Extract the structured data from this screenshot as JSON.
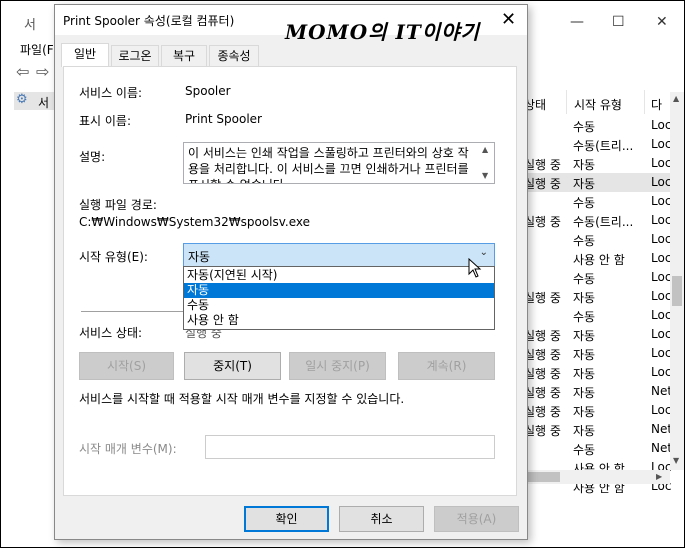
{
  "background_window": {
    "title_partial": "서",
    "menu_partial": "파일(F",
    "tree_partial": "서",
    "col_status": "상태",
    "col_startup": "시작 유형",
    "col_logon_partial": "다",
    "rows": [
      {
        "status": "",
        "startup": "수동",
        "logon": "Loc"
      },
      {
        "status": "",
        "startup": "수동(트리...",
        "logon": "Loc"
      },
      {
        "status": "실행 중",
        "startup": "자동",
        "logon": "Loc"
      },
      {
        "status": "실행 중",
        "startup": "자동",
        "logon": "Loc"
      },
      {
        "status": "",
        "startup": "수동",
        "logon": "Loc"
      },
      {
        "status": "실행 중",
        "startup": "수동(트리...",
        "logon": "Loc"
      },
      {
        "status": "",
        "startup": "수동",
        "logon": "Loc"
      },
      {
        "status": "",
        "startup": "사용 안 함",
        "logon": "Loc"
      },
      {
        "status": "",
        "startup": "수동",
        "logon": "Loc"
      },
      {
        "status": "실행 중",
        "startup": "자동",
        "logon": "Loc"
      },
      {
        "status": "",
        "startup": "수동",
        "logon": "Loc"
      },
      {
        "status": "실행 중",
        "startup": "자동",
        "logon": "Loc"
      },
      {
        "status": "실행 중",
        "startup": "자동",
        "logon": "Loc"
      },
      {
        "status": "실행 중",
        "startup": "자동",
        "logon": "Loc"
      },
      {
        "status": "실행 중",
        "startup": "자동",
        "logon": "Net"
      },
      {
        "status": "실행 중",
        "startup": "자동",
        "logon": "Loc"
      },
      {
        "status": "실행 중",
        "startup": "자동",
        "logon": "Net"
      },
      {
        "status": "",
        "startup": "수동",
        "logon": "Net"
      },
      {
        "status": "",
        "startup": "사용 안 함",
        "logon": "Loc"
      },
      {
        "status": "",
        "startup": "사용 안 함",
        "logon": "Loc"
      }
    ]
  },
  "watermark": "MOMO의 IT이야기",
  "dialog": {
    "title": "Print Spooler 속성(로컬 컴퓨터)",
    "tabs": [
      "일반",
      "로그온",
      "복구",
      "종속성"
    ],
    "service_name_label": "서비스 이름:",
    "service_name_value": "Spooler",
    "display_name_label": "표시 이름:",
    "display_name_value": "Print Spooler",
    "description_label": "설명:",
    "description_value": "이 서비스는 인쇄 작업을 스풀링하고 프린터와의 상호 작용을 처리합니다. 이 서비스를 끄면 인쇄하거나 프린터를 표시할 수 없습니다",
    "exe_path_label": "실행 파일 경로:",
    "exe_path_value": "C:₩Windows₩System32₩spoolsv.exe",
    "startup_type_label": "시작 유형(E):",
    "startup_type_value": "자동",
    "startup_options": [
      "자동(지연된 시작)",
      "자동",
      "수동",
      "사용 안 함"
    ],
    "startup_selected_index": 1,
    "service_status_label": "서비스 상태:",
    "service_status_value": "실행 중",
    "buttons": {
      "start": "시작(S)",
      "stop": "중지(T)",
      "pause": "일시 중지(P)",
      "resume": "계속(R)"
    },
    "hint_text": "서비스를 시작할 때 적용할 시작 매개 변수를 지정할 수 있습니다.",
    "start_params_label": "시작 매개 변수(M):",
    "start_params_value": "",
    "footer": {
      "ok": "확인",
      "cancel": "취소",
      "apply": "적용(A)"
    }
  }
}
